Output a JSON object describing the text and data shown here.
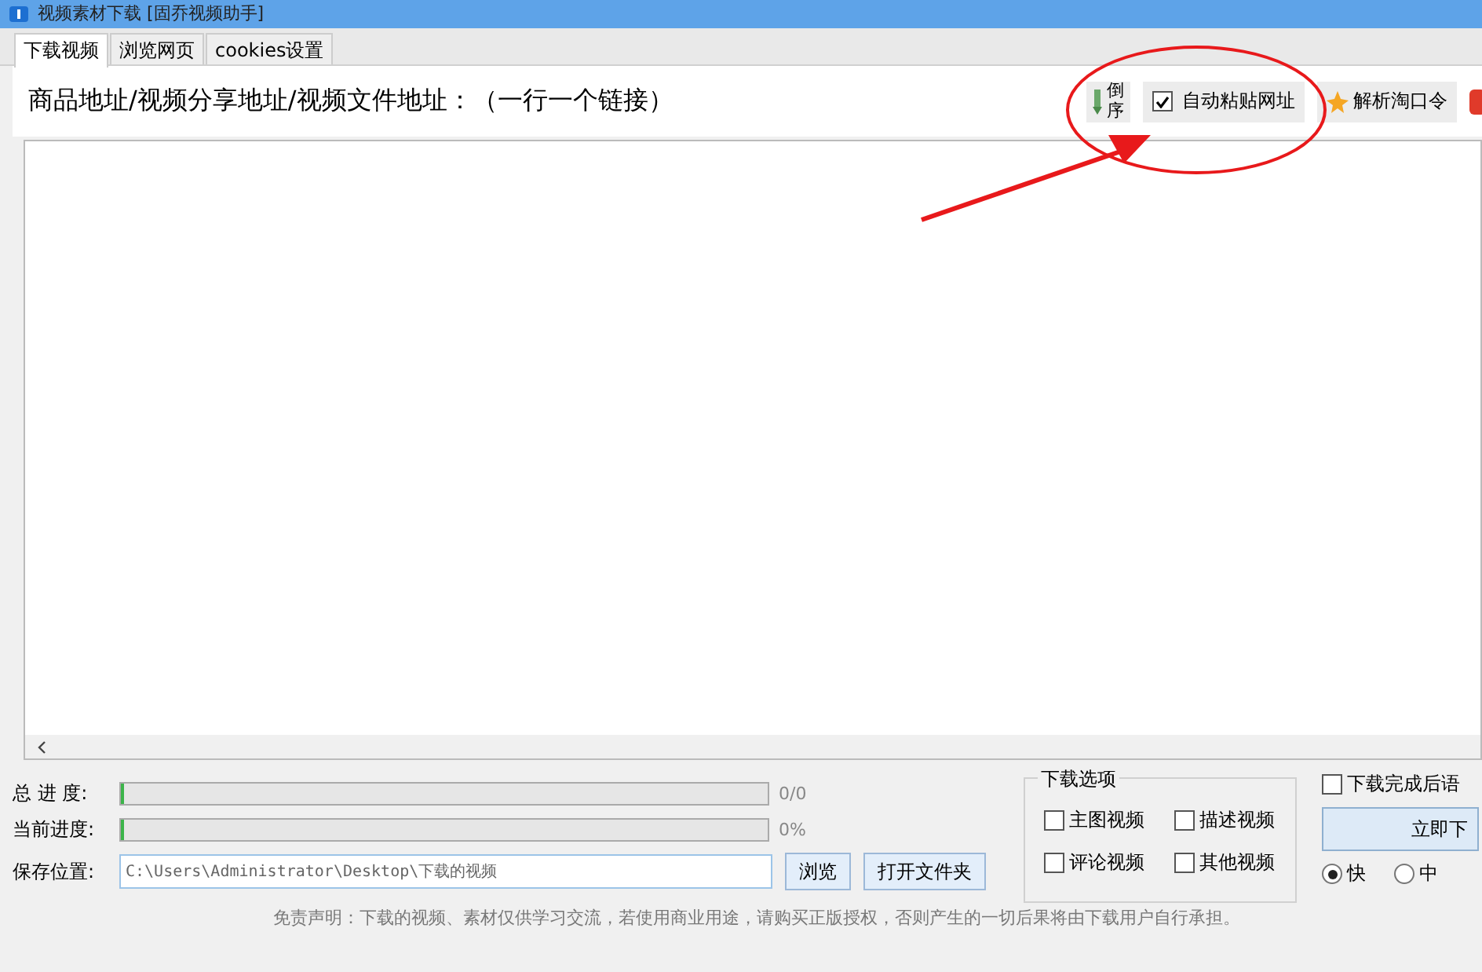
{
  "window": {
    "title": "视频素材下载 [固乔视频助手]"
  },
  "tabs": [
    {
      "label": "下载视频",
      "selected": true
    },
    {
      "label": "浏览网页",
      "selected": false
    },
    {
      "label": "cookies设置",
      "selected": false
    }
  ],
  "url_label": "商品地址/视频分享地址/视频文件地址：（一行一个链接）",
  "toolbar": {
    "reverse_label": "倒序",
    "auto_paste": {
      "label": "自动粘贴网址",
      "checked": true
    },
    "parse_label": "解析淘口令"
  },
  "progress": [
    {
      "label": "总 进 度:",
      "level": 0,
      "reading": "0/0"
    },
    {
      "label": "当前进度:",
      "level": 0,
      "reading": "0%"
    }
  ],
  "save": {
    "label": "保存位置:",
    "value": "C:\\Users\\Administrator\\Desktop\\下载的视频",
    "browse": "浏览",
    "open_folder": "打开文件夹"
  },
  "options": {
    "title": "下载选项",
    "items": [
      {
        "label": "主图视频",
        "checked": false
      },
      {
        "label": "描述视频",
        "checked": false
      },
      {
        "label": "评论视频",
        "checked": false
      },
      {
        "label": "其他视频",
        "checked": false
      }
    ]
  },
  "after_done": {
    "label": "下载完成后语",
    "checked": false
  },
  "start_button": "立即下",
  "speeds": [
    {
      "label": "快",
      "selected": true
    },
    {
      "label": "中",
      "selected": false
    }
  ],
  "disclaimer": "免责声明：下载的视频、素材仅供学习交流，若使用商业用途，请购买正版授权，否则产生的一切后果将由下载用户自行承担。"
}
